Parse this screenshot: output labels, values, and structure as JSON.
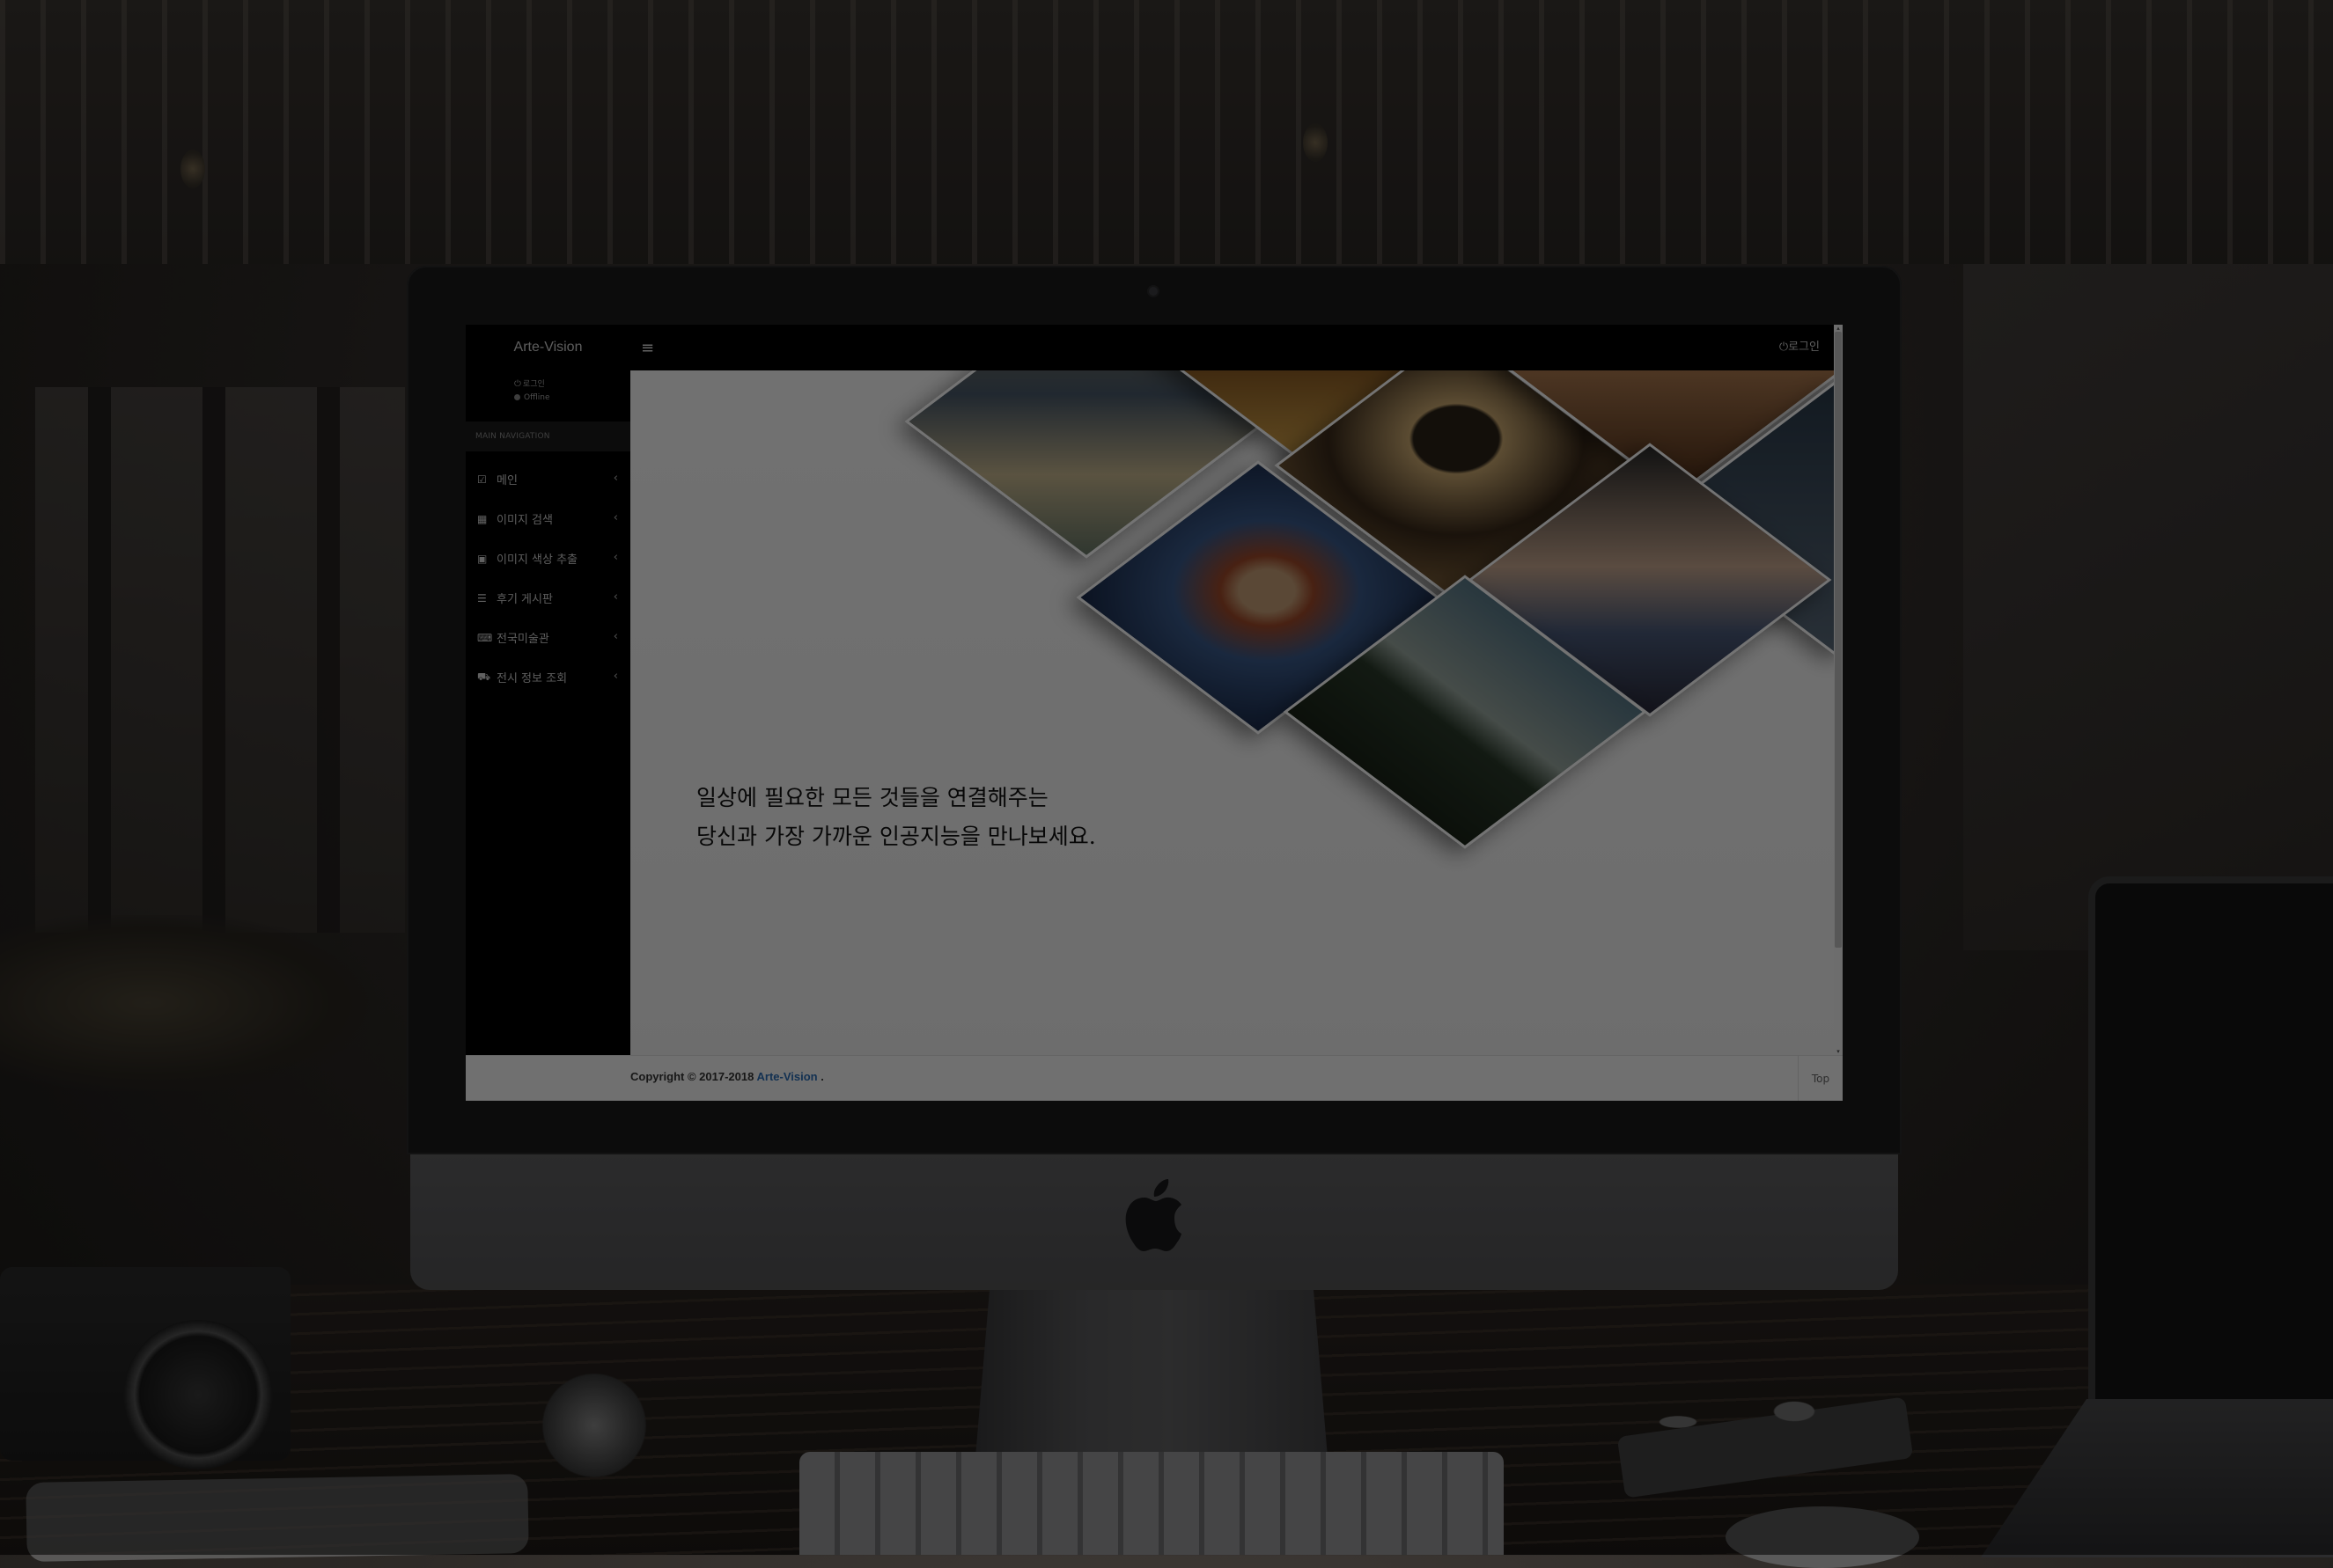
{
  "app": {
    "brand": "Arte-Vision",
    "user_status_login": "로그인",
    "user_status_offline": "Offline",
    "topbar_login": "로그인",
    "topbar_menu_icon": "hamburger-icon"
  },
  "sidebar": {
    "nav_header": "MAIN NAVIGATION",
    "items": [
      {
        "label": "메인",
        "icon": "checkbox-icon"
      },
      {
        "label": "이미지 검색",
        "icon": "table-icon"
      },
      {
        "label": "이미지 색상 추출",
        "icon": "image-icon"
      },
      {
        "label": "후기 게시판",
        "icon": "list-icon"
      },
      {
        "label": "전국미술관",
        "icon": "keyboard-icon"
      },
      {
        "label": "전시 정보 조회",
        "icon": "car-icon"
      }
    ]
  },
  "main": {
    "headline_line1": "일상에 필요한 모든 것들을 연결해주는",
    "headline_line2": "당신과 가장 가까운 인공지능을 만나보세요."
  },
  "footer": {
    "copyright_prefix": "Copyright © 2017-2018",
    "brand_link": "Arte-Vision",
    "suffix": ".",
    "top_button": "Top"
  },
  "colors": {
    "sidebar_bg": "#000000",
    "link": "#2a6db5",
    "content_bg": "#f5f5f5"
  }
}
